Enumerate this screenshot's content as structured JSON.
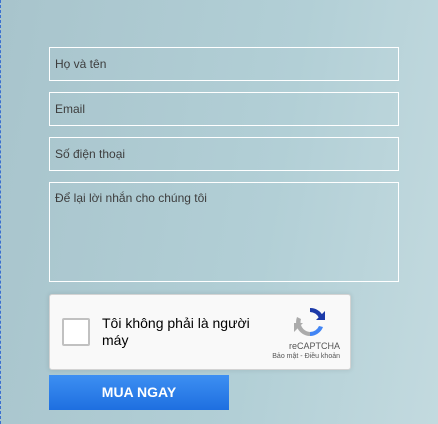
{
  "form": {
    "name_placeholder": "Họ và tên",
    "email_placeholder": "Email",
    "phone_placeholder": "Số điện thoại",
    "message_placeholder": "Để lại lời nhắn cho chúng tôi",
    "submit_label": "MUA NGAY"
  },
  "recaptcha": {
    "checkbox_label": "Tôi không phải là người máy",
    "brand": "reCAPTCHA",
    "privacy_link": "Bảo mật",
    "separator": " - ",
    "terms_link": "Điều khoản",
    "icon": "recaptcha-logo-icon"
  },
  "colors": {
    "background": "#aac6cd",
    "field_border": "#ffffff",
    "button": "#2a7be8",
    "button_text": "#ffffff"
  }
}
